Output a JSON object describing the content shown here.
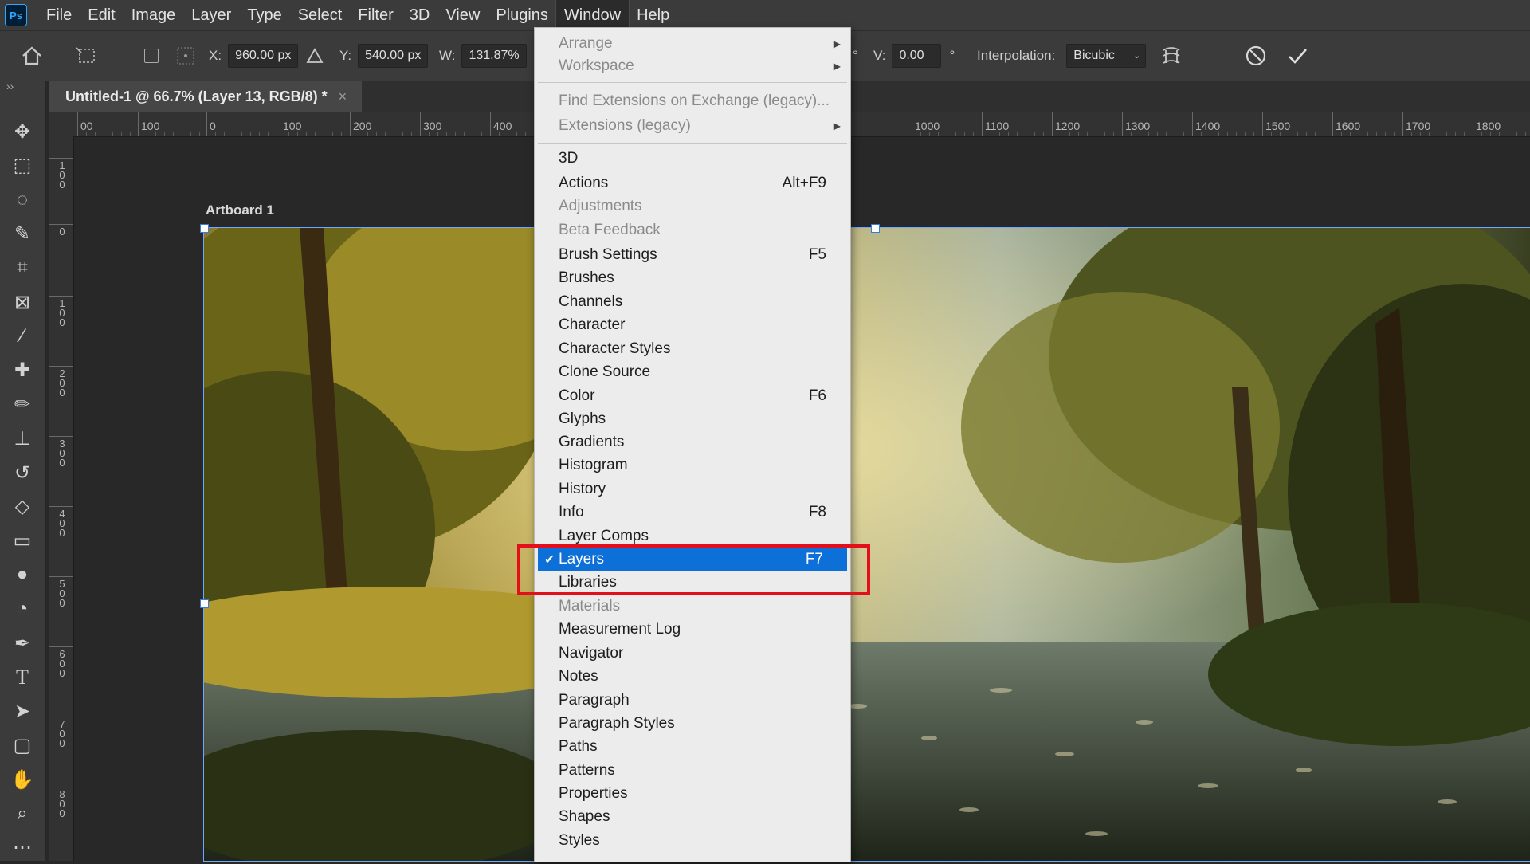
{
  "app": {
    "logo": "Ps"
  },
  "menubar": {
    "items": [
      "File",
      "Edit",
      "Image",
      "Layer",
      "Type",
      "Select",
      "Filter",
      "3D",
      "View",
      "Plugins",
      "Window",
      "Help"
    ],
    "active": "Window"
  },
  "options": {
    "x_label": "X:",
    "x_value": "960.00 px",
    "y_label": "Y:",
    "y_value": "540.00 px",
    "w_label": "W:",
    "w_value": "131.87%",
    "v_label": "V:",
    "v_value": "0.00",
    "degree": "°",
    "interp_label": "Interpolation:",
    "interp_value": "Bicubic"
  },
  "document": {
    "tab_title": "Untitled-1 @ 66.7% (Layer 13, RGB/8) *",
    "tab_close": "×",
    "artboard_label": "Artboard 1"
  },
  "rulers": {
    "horizontal": [
      "00",
      "100",
      "0",
      "100",
      "200",
      "300",
      "400",
      "1000",
      "1100",
      "1200",
      "1300",
      "1400",
      "1500",
      "1600",
      "1700",
      "1800"
    ],
    "vertical": [
      "100",
      "0",
      "100",
      "200",
      "300",
      "400",
      "500",
      "600",
      "700",
      "800"
    ]
  },
  "window_menu": {
    "items": [
      {
        "label": "Arrange",
        "submenu": true,
        "disabled": true
      },
      {
        "label": "Workspace",
        "submenu": true,
        "disabled": true
      },
      {
        "label": "Find Extensions on Exchange (legacy)...",
        "disabled": true
      },
      {
        "label": "Extensions (legacy)",
        "submenu": true,
        "disabled": true
      },
      {
        "label": "3D"
      },
      {
        "label": "Actions",
        "shortcut": "Alt+F9"
      },
      {
        "label": "Adjustments",
        "disabled": true
      },
      {
        "label": "Beta Feedback",
        "disabled": true
      },
      {
        "label": "Brush Settings",
        "shortcut": "F5"
      },
      {
        "label": "Brushes"
      },
      {
        "label": "Channels"
      },
      {
        "label": "Character"
      },
      {
        "label": "Character Styles"
      },
      {
        "label": "Clone Source"
      },
      {
        "label": "Color",
        "shortcut": "F6"
      },
      {
        "label": "Glyphs"
      },
      {
        "label": "Gradients"
      },
      {
        "label": "Histogram"
      },
      {
        "label": "History"
      },
      {
        "label": "Info",
        "shortcut": "F8"
      },
      {
        "label": "Layer Comps"
      },
      {
        "label": "Layers",
        "shortcut": "F7",
        "checked": true,
        "selected": true
      },
      {
        "label": "Libraries"
      },
      {
        "label": "Materials",
        "disabled": true
      },
      {
        "label": "Measurement Log"
      },
      {
        "label": "Navigator"
      },
      {
        "label": "Notes"
      },
      {
        "label": "Paragraph"
      },
      {
        "label": "Paragraph Styles"
      },
      {
        "label": "Paths"
      },
      {
        "label": "Patterns"
      },
      {
        "label": "Properties"
      },
      {
        "label": "Shapes"
      },
      {
        "label": "Styles"
      }
    ],
    "check_glyph": "✔",
    "submenu_glyph": "▶"
  },
  "icons": {
    "tools": [
      "move-icon",
      "marquee-icon",
      "lasso-icon",
      "quick-select-icon",
      "crop-icon",
      "frame-icon",
      "eyedropper-icon",
      "healing-icon",
      "brush-icon",
      "stamp-icon",
      "history-brush-icon",
      "eraser-icon",
      "gradient-icon",
      "blur-icon",
      "dodge-icon",
      "pen-icon",
      "type-icon",
      "path-select-icon",
      "rectangle-icon",
      "hand-icon",
      "zoom-icon",
      "more-icon"
    ]
  },
  "colors": {
    "accent": "#0d6fd8",
    "highlight": "#e3101c",
    "menu_bg": "#ececec"
  }
}
